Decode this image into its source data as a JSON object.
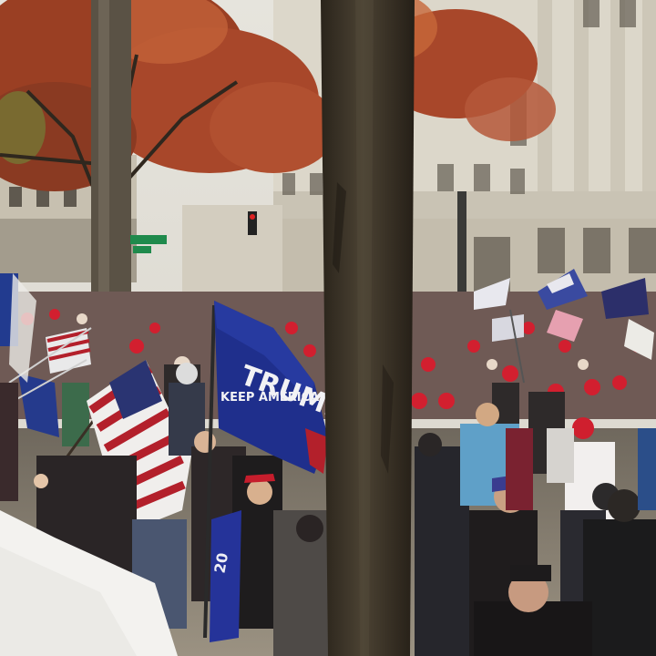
{
  "scene": {
    "street_sign": "",
    "flag_main_line1": "TRUMP",
    "flag_main_line2": "KEEP AMERICA",
    "flag_lower_text": "20",
    "colors": {
      "sky": "#e3e1da",
      "building": "#d9d4c6",
      "building_shadow": "#b9b3a4",
      "tree_trunk": "#3b3327",
      "foliage": "#9a3f23",
      "foliage_light": "#c7683a",
      "flag_blue": "#1f2f8c",
      "flag_red": "#b3202b",
      "hat_red": "#d21f2f",
      "pavement": "#8e8678",
      "street_sign_green": "#1f8a4c"
    }
  }
}
